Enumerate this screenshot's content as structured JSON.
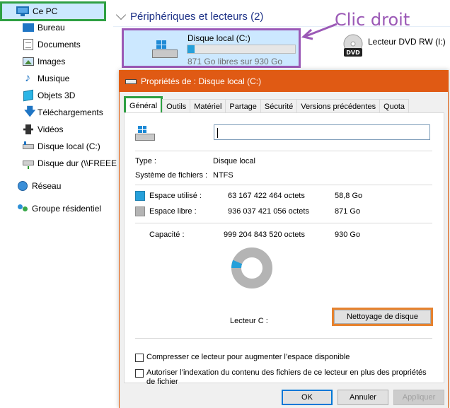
{
  "sidebar": {
    "this_pc": "Ce PC",
    "items": [
      {
        "label": "Bureau",
        "icon": "desktop-folder-icon"
      },
      {
        "label": "Documents",
        "icon": "documents-icon"
      },
      {
        "label": "Images",
        "icon": "pictures-icon"
      },
      {
        "label": "Musique",
        "icon": "music-icon"
      },
      {
        "label": "Objets 3D",
        "icon": "3d-objects-icon"
      },
      {
        "label": "Téléchargements",
        "icon": "downloads-icon"
      },
      {
        "label": "Vidéos",
        "icon": "videos-icon"
      },
      {
        "label": "Disque local (C:)",
        "icon": "local-drive-icon"
      },
      {
        "label": "Disque dur (\\\\FREEE",
        "icon": "network-drive-icon"
      }
    ],
    "network": "Réseau",
    "homegroup": "Groupe résidentiel"
  },
  "main": {
    "section_title": "Périphériques et lecteurs (2)",
    "annotation": "Clic droit",
    "drive_c": {
      "name": "Disque local (C:)",
      "free_text": "871 Go libres sur 930 Go",
      "used_fraction": 0.063
    },
    "dvd": {
      "name": "Lecteur DVD RW (I:)",
      "badge": "DVD"
    }
  },
  "dialog": {
    "title": "Propriétés de : Disque local (C:)",
    "tabs": [
      "Général",
      "Outils",
      "Matériel",
      "Partage",
      "Sécurité",
      "Versions précédentes",
      "Quota"
    ],
    "active_tab": 0,
    "name_value": "",
    "type_label": "Type :",
    "type_value": "Disque local",
    "fs_label": "Système de fichiers :",
    "fs_value": "NTFS",
    "used_label": "Espace utilisé :",
    "used_bytes": "63 167 422 464 octets",
    "used_size": "58,8 Go",
    "free_label": "Espace libre :",
    "free_bytes": "936 037 421 056 octets",
    "free_size": "871 Go",
    "capacity_label": "Capacité :",
    "capacity_bytes": "999 204 843 520 octets",
    "capacity_size": "930 Go",
    "drive_label": "Lecteur C :",
    "cleanup_button": "Nettoyage de disque",
    "compress_label": "Compresser ce lecteur pour augmenter l’espace disponible",
    "index_label": "Autoriser l’indexation du contenu des fichiers de ce lecteur en plus des propriétés de fichier",
    "ok": "OK",
    "cancel": "Annuler",
    "apply": "Appliquer",
    "used_fraction": 0.063
  },
  "colors": {
    "used": "#26a0da",
    "free": "#b4b4b4",
    "titlebar": "#e05a14",
    "highlight_green": "#2ea043",
    "highlight_purple": "#9b59b6",
    "highlight_orange": "#e6822e"
  }
}
